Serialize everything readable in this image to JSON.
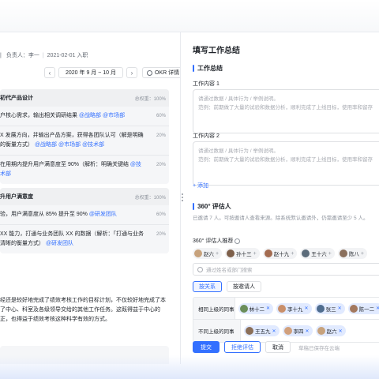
{
  "left": {
    "meta": {
      "separator": "|",
      "owner_label": "负责人：李一",
      "join_date": "2021-02-01 入职"
    },
    "period": {
      "prev_icon": "chevron-left-icon",
      "label": "2020 年 9 月 ~ 10 月",
      "next_icon": "chevron-right-icon"
    },
    "okr_button": "OKR 详情",
    "objectives": [
      {
        "title": "初代产品设计",
        "weight": "总权重：100%",
        "krs": [
          {
            "text": "户核心需求，输出相关调研结果",
            "tags": [
              "@战略部",
              "@市场部"
            ],
            "pct": "60%"
          },
          {
            "text": "X 发展方向，并输出产品方案，获得各团队认可（解是明确的衡量方式）",
            "tags": [
              "@战略部",
              "@市场部",
              "@技术部"
            ],
            "pct": "20%"
          },
          {
            "text": "在用期内提升用户满意度至 90%（解析：明确关键结",
            "tags": [
              "@技术部"
            ],
            "pct": "20%"
          }
        ]
      },
      {
        "title": "升用户满意度",
        "weight": "总权重：100%",
        "krs": [
          {
            "text": "验，用户满意度从 85% 提升至 90%",
            "tags": [
              "@研发团队"
            ],
            "pct": "60%"
          },
          {
            "text": "XX 能力，打通与业务团队 XX 的数据（解析：「打通与业务清晰的衡量方式）",
            "tags": [
              "@研发团队"
            ],
            "pct": "20%"
          }
        ]
      }
    ],
    "summary": "经还是较好地完成了绩效考核工作的目标计划，不仅较好地完成了本了中心、科室及各级领导交给的其他工作任务。这既得益于中心的正，也得益于绩效考核这种科学有效的方式。"
  },
  "right": {
    "title": "填写工作总结",
    "section_title": "工作总结",
    "field1_label": "工作内容 1",
    "field2_label": "工作内容 2",
    "textarea_placeholder_1": "请通过数据 / 具体行为 / 举例说明。",
    "textarea_placeholder_2": "范例：前期做了大量的试验和数据分析，顺利完成了上线目标，使用率和留存",
    "add_label": "+ 添加",
    "reviewer_title": "360° 评估人",
    "reviewer_desc": "已邀请 7 人。可按邀请人查看来源。除系统默认邀请外，仍需邀请至少 5 人。",
    "recommend_label": "360° 评估人推荐",
    "recommended": [
      "赵六",
      "孙十三",
      "赵十九",
      "王十六",
      "陈八"
    ],
    "search_placeholder": "通过姓名或部门搜索",
    "tabs": [
      "按关系",
      "按邀请人"
    ],
    "relations": [
      {
        "label": "相同上级的同事",
        "people": [
          "林十二",
          "李十九",
          "张三",
          "陈一二"
        ]
      },
      {
        "label": "不同上级的同事",
        "people": [
          "王五九",
          "李四",
          "赵六"
        ]
      }
    ],
    "buttons": {
      "submit": "提交",
      "reject": "拒绝评估",
      "cancel": "取消"
    },
    "draft_note": "草稿已保存在云端"
  }
}
